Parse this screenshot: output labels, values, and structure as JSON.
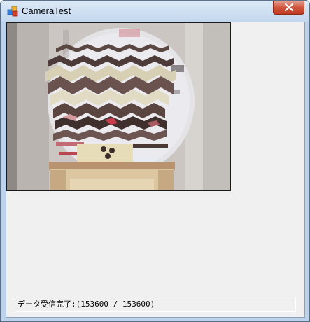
{
  "window": {
    "title": "CameraTest"
  },
  "status": {
    "text": "データ受信完了:(153600 / 153600)"
  },
  "icons": {
    "app": "app-blocks-icon",
    "close": "close-icon"
  }
}
